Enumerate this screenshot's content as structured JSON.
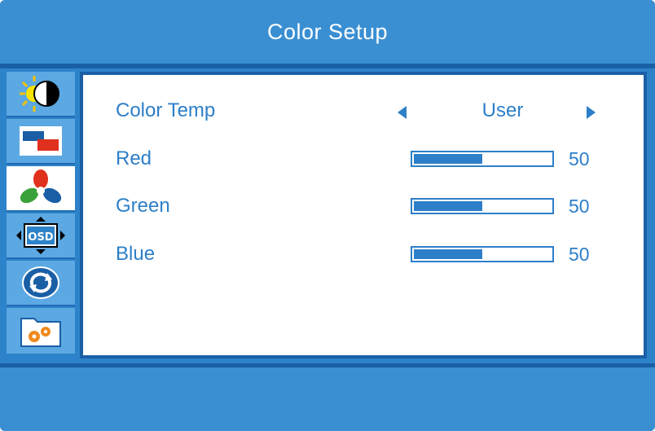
{
  "title": "Color Setup",
  "sidebar": {
    "items": [
      {
        "icon": "brightness-contrast-icon",
        "active": false
      },
      {
        "icon": "image-setup-icon",
        "active": false
      },
      {
        "icon": "color-setup-icon",
        "active": true
      },
      {
        "icon": "osd-setup-icon",
        "active": false
      },
      {
        "icon": "reset-icon",
        "active": false
      },
      {
        "icon": "settings-folder-icon",
        "active": false
      }
    ]
  },
  "menu": {
    "color_temp": {
      "label": "Color Temp",
      "value": "User"
    },
    "red": {
      "label": "Red",
      "value": "50",
      "level": 0.5
    },
    "green": {
      "label": "Green",
      "value": "50",
      "level": 0.5
    },
    "blue": {
      "label": "Blue",
      "value": "50",
      "level": 0.5
    }
  },
  "colors": {
    "background": "#3a8fd3",
    "accent_text": "#2d7fc8",
    "panel": "#ffffff",
    "rule": "#1a5fa6"
  }
}
